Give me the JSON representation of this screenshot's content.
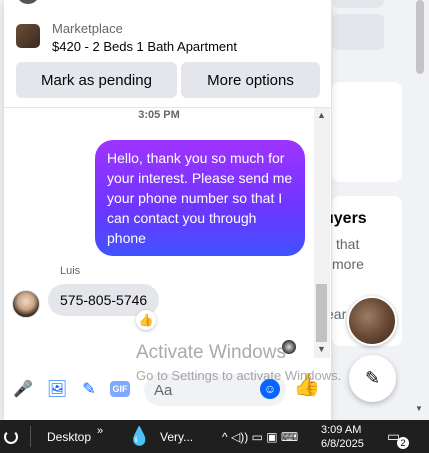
{
  "background": {
    "partial_texts": {
      "buyers": "uyers",
      "that": "that",
      "more": "more",
      "learn": "ear"
    }
  },
  "chat": {
    "marketplace": {
      "label": "Marketplace",
      "title": "$420 - 2 Beds 1 Bath Apartment",
      "mark_pending_label": "Mark as pending",
      "more_options_label": "More options"
    },
    "timestamp": "3:05 PM",
    "sent_message": "Hello, thank you so much for your interest. Please send me your phone number so that I can contact you through phone",
    "sender_name": "Luis",
    "received_message": "575-805-5746",
    "reaction": "👍",
    "composer": {
      "placeholder": "Aa",
      "gif_label": "GIF",
      "mic_icon": "🎤",
      "photo_icon": "🖼",
      "sticker_icon": "✎",
      "emoji_icon": "☺",
      "like_icon": "👍"
    }
  },
  "watermark": {
    "line1": "Activate Windows",
    "line2": "Go to Settings to activate Windows."
  },
  "compose_icon": "✎",
  "taskbar": {
    "desktop_label": "Desktop",
    "chevron": "»",
    "app_label": "Very...",
    "system_icons": "^ ◁)) ▭ ▣ ⌨",
    "time": "3:09 AM",
    "date": "6/8/2025",
    "notification_count": "2"
  },
  "colors": {
    "accent": "#0866ff",
    "sent_bubble_top": "#a033ff",
    "sent_bubble_bottom": "#3f53ff",
    "taskbar_bg": "#1f1f1f"
  }
}
